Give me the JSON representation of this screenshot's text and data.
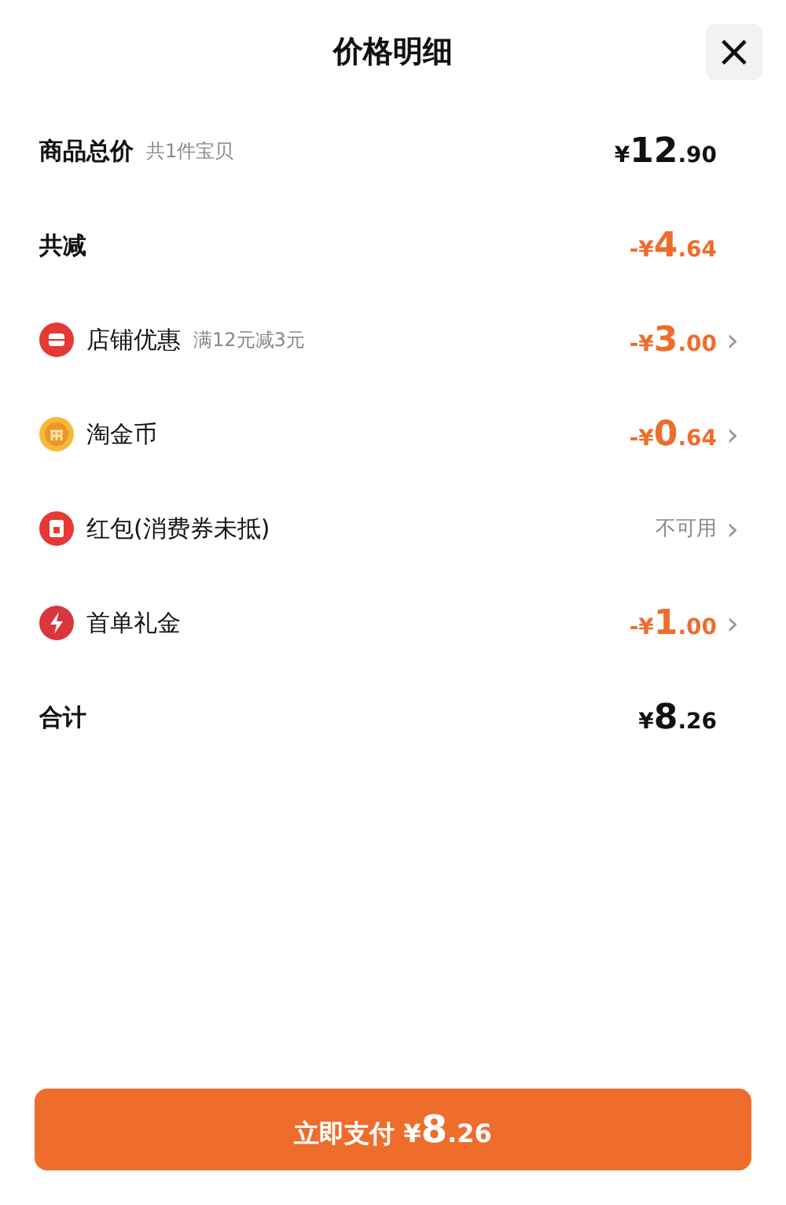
{
  "header": {
    "title": "价格明细",
    "close": "×"
  },
  "rows": [
    {
      "kind": "total",
      "label": "商品总价",
      "note": "共1件宝贝",
      "value": "¥12.90"
    },
    {
      "kind": "saving",
      "label": "共减",
      "value": "-¥4.64"
    },
    {
      "kind": "discount",
      "label": "店铺优惠",
      "note": "满12元减3元",
      "value": "-¥3.00",
      "chevron": "›"
    },
    {
      "kind": "discount",
      "label": "淘金币",
      "value": "-¥0.64",
      "chevron": "›"
    },
    {
      "kind": "unavailable",
      "label": "红包(消费券未抵)",
      "value": "不可用",
      "chevron": "›"
    },
    {
      "kind": "discount",
      "label": "首单礼金",
      "value": "-¥1.00",
      "chevron": "›"
    },
    {
      "kind": "total",
      "label": "合计",
      "value": "¥8.26"
    }
  ],
  "pay_button": {
    "label": "立即支付",
    "amount": "¥8.26"
  }
}
